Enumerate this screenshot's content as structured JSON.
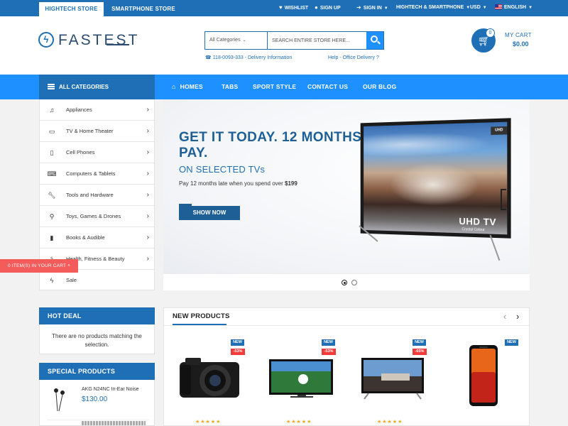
{
  "topbar": {
    "tabs": [
      "HIGHTECH STORE",
      "SMARTPHONE STORE"
    ],
    "wishlist": "WISHLIST",
    "signup": "SIGN UP",
    "signin": "SIGN IN",
    "store_select": "HIGHTECH & SMARTPHONE",
    "currency": "USD",
    "language": "ENGLISH"
  },
  "header": {
    "logo": "FASTEST",
    "search": {
      "category": "All Categories",
      "placeholder": "SEARCH ENTIRE STORE HERE..."
    },
    "phone": "118-0093-333 - Delivery Information",
    "help": "Help - Office Delivery ?",
    "cart": {
      "count": "0",
      "label": "MY CART",
      "total": "$0.00"
    }
  },
  "nav": {
    "all_categories": "ALL CATEGORIES",
    "items": [
      "HOMES",
      "TABS",
      "SPORT STYLE",
      "CONTACT US",
      "OUR BLOG"
    ]
  },
  "categories": [
    {
      "label": "Appliances",
      "icon": "music-note-icon"
    },
    {
      "label": "TV & Home Theater",
      "icon": "monitor-icon"
    },
    {
      "label": "Cell Phones",
      "icon": "phone-icon"
    },
    {
      "label": "Computers & Tablets",
      "icon": "laptop-icon"
    },
    {
      "label": "Tools and Hardware",
      "icon": "wrench-icon"
    },
    {
      "label": "Toys, Games & Drones",
      "icon": "pin-icon"
    },
    {
      "label": "Books & Audible",
      "icon": "book-icon"
    },
    {
      "label": "Health, Fitness & Beauty",
      "icon": "stethoscope-icon"
    },
    {
      "label": "Sale",
      "icon": "bolt-icon"
    }
  ],
  "slider": {
    "title": "GET IT TODAY. 12 MONTHS TO PAY.",
    "subtitle": "ON SELECTED TVs",
    "desc": "Pay 12 months late when you spend over",
    "desc_amount": "$199",
    "button": "SHOW NOW",
    "tv_logo": "UHD TV",
    "tv_caption": "Crystal Colour",
    "tv_badge": "UHD"
  },
  "floating_cart": "0 ITEM(S) IN YOUR CART",
  "hot_deal": {
    "title": "HOT DEAL",
    "empty": "There are no products matching the selection."
  },
  "special_products": {
    "title": "SPECIAL PRODUCTS",
    "items": [
      {
        "name": "AKG N24NC In-Ear Noise",
        "price": "$130.00"
      }
    ]
  },
  "new_products": {
    "title": "NEW PRODUCTS",
    "items": [
      {
        "badge": "NEW",
        "discount": "-53%"
      },
      {
        "badge": "NEW",
        "discount": "-53%"
      },
      {
        "badge": "NEW",
        "discount": "-65%"
      },
      {
        "badge": "NEW",
        "discount": ""
      }
    ]
  },
  "colors": {
    "primary": "#1e6fb6",
    "accent": "#1e90ff",
    "sale": "#f23b3b",
    "cart_tab": "#f45b5b"
  }
}
